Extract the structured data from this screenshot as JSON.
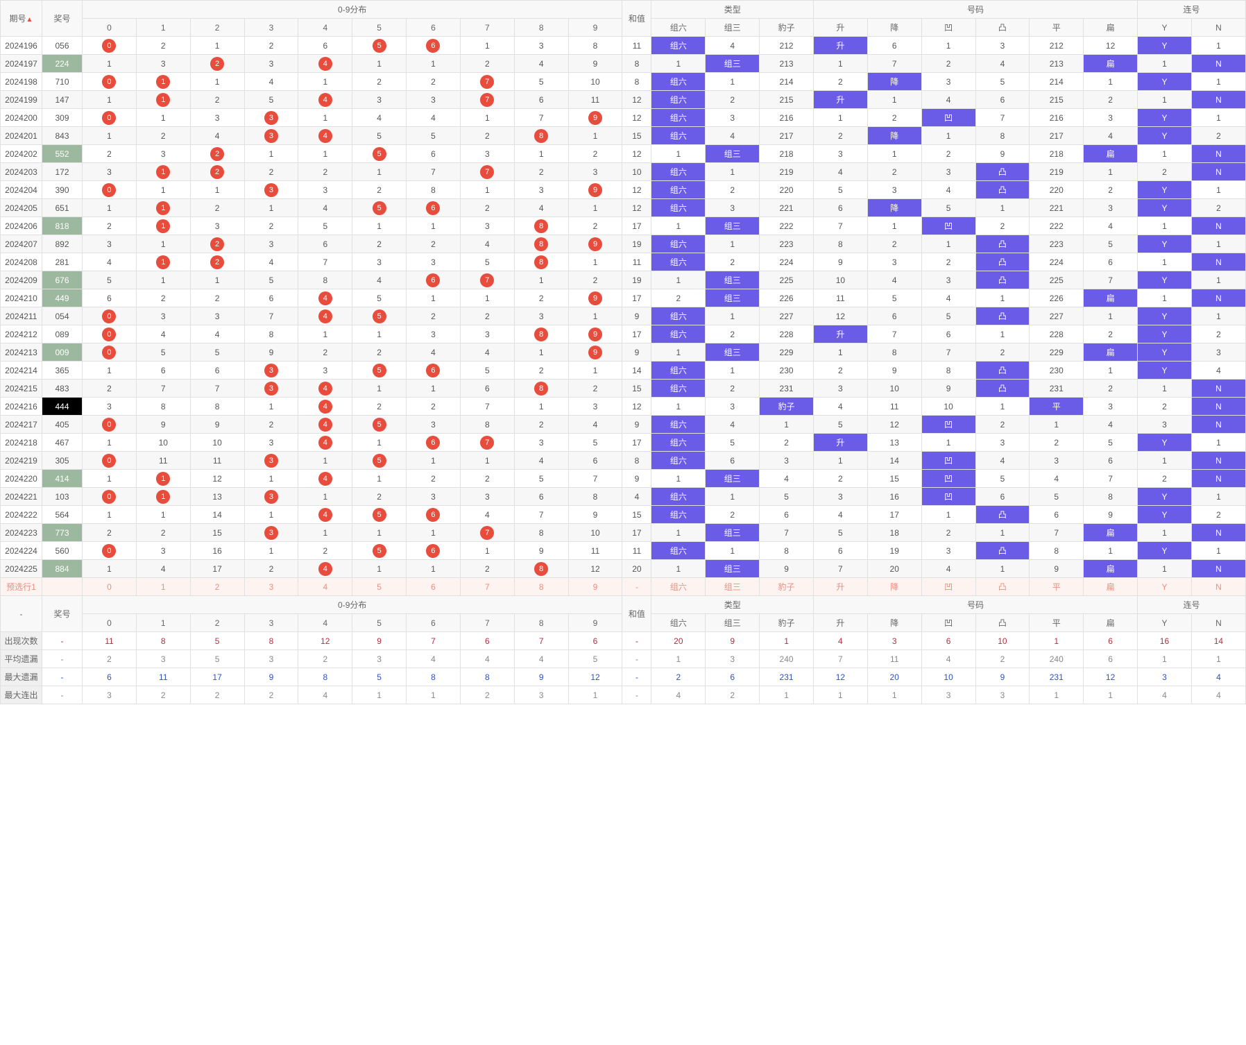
{
  "headers": {
    "period": "期号",
    "award": "奖号",
    "dist": "0-9分布",
    "sum": "和值",
    "type": "类型",
    "num": "号码",
    "con": "连号",
    "type_cols": [
      "组六",
      "组三",
      "豹子"
    ],
    "num_cols": [
      "升",
      "降",
      "凹",
      "凸",
      "平",
      "扁"
    ],
    "con_cols": [
      "Y",
      "N"
    ],
    "dist_cols": [
      "0",
      "1",
      "2",
      "3",
      "4",
      "5",
      "6",
      "7",
      "8",
      "9"
    ]
  },
  "rows": [
    {
      "p": "2024196",
      "a": "056",
      "d": [
        0,
        2,
        1,
        2,
        6,
        5,
        6,
        1,
        3,
        8
      ],
      "h": [
        0,
        5,
        6
      ],
      "sum": 11,
      "t": [
        "组六",
        4,
        212
      ],
      "th": [
        0
      ],
      "n": [
        "升",
        6,
        1,
        3,
        212,
        12
      ],
      "nh": [
        0
      ],
      "c": [
        "Y",
        1
      ],
      "ch": [
        0
      ]
    },
    {
      "p": "2024197",
      "a": "224",
      "ag": 1,
      "d": [
        1,
        3,
        2,
        3,
        4,
        1,
        1,
        2,
        4,
        9
      ],
      "h": [
        2,
        4
      ],
      "sum": 8,
      "t": [
        1,
        "组三",
        213
      ],
      "th": [
        1
      ],
      "n": [
        1,
        7,
        2,
        4,
        213,
        "扁"
      ],
      "nh": [
        5
      ],
      "c": [
        1,
        "N"
      ],
      "ch": [
        1
      ]
    },
    {
      "p": "2024198",
      "a": "710",
      "d": [
        0,
        1,
        1,
        4,
        1,
        2,
        2,
        7,
        5,
        10
      ],
      "h": [
        0,
        1,
        7
      ],
      "sum": 8,
      "t": [
        "组六",
        1,
        214
      ],
      "th": [
        0
      ],
      "n": [
        2,
        "降",
        3,
        5,
        214,
        1
      ],
      "nh": [
        1
      ],
      "c": [
        "Y",
        1
      ],
      "ch": [
        0
      ]
    },
    {
      "p": "2024199",
      "a": "147",
      "d": [
        1,
        1,
        2,
        5,
        4,
        3,
        3,
        7,
        6,
        11
      ],
      "h": [
        1,
        4,
        7
      ],
      "sum": 12,
      "t": [
        "组六",
        2,
        215
      ],
      "th": [
        0
      ],
      "n": [
        "升",
        1,
        4,
        6,
        215,
        2
      ],
      "nh": [
        0
      ],
      "c": [
        1,
        "N"
      ],
      "ch": [
        1
      ]
    },
    {
      "p": "2024200",
      "a": "309",
      "d": [
        0,
        1,
        3,
        3,
        1,
        4,
        4,
        1,
        7,
        9
      ],
      "h": [
        0,
        3,
        9
      ],
      "sum": 12,
      "t": [
        "组六",
        3,
        216
      ],
      "th": [
        0
      ],
      "n": [
        1,
        2,
        "凹",
        7,
        216,
        3
      ],
      "nh": [
        2
      ],
      "c": [
        "Y",
        1
      ],
      "ch": [
        0
      ]
    },
    {
      "p": "2024201",
      "a": "843",
      "d": [
        1,
        2,
        4,
        3,
        4,
        5,
        5,
        2,
        8,
        1
      ],
      "h": [
        3,
        4,
        8
      ],
      "sum": 15,
      "t": [
        "组六",
        4,
        217
      ],
      "th": [
        0
      ],
      "n": [
        2,
        "降",
        1,
        8,
        217,
        4
      ],
      "nh": [
        1
      ],
      "c": [
        "Y",
        2
      ],
      "ch": [
        0
      ]
    },
    {
      "p": "2024202",
      "a": "552",
      "ag": 1,
      "d": [
        2,
        3,
        2,
        1,
        1,
        5,
        6,
        3,
        1,
        2
      ],
      "h": [
        2,
        5
      ],
      "sum": 12,
      "t": [
        1,
        "组三",
        218
      ],
      "th": [
        1
      ],
      "n": [
        3,
        1,
        2,
        9,
        218,
        "扁"
      ],
      "nh": [
        5
      ],
      "c": [
        1,
        "N"
      ],
      "ch": [
        1
      ]
    },
    {
      "p": "2024203",
      "a": "172",
      "d": [
        3,
        1,
        2,
        2,
        2,
        1,
        7,
        7,
        2,
        3
      ],
      "h": [
        1,
        2,
        7
      ],
      "sum": 10,
      "t": [
        "组六",
        1,
        219
      ],
      "th": [
        0
      ],
      "n": [
        4,
        2,
        3,
        "凸",
        219,
        1
      ],
      "nh": [
        3
      ],
      "c": [
        2,
        "N"
      ],
      "ch": [
        1
      ]
    },
    {
      "p": "2024204",
      "a": "390",
      "d": [
        0,
        1,
        1,
        3,
        3,
        2,
        8,
        1,
        3,
        9
      ],
      "h": [
        0,
        3,
        9
      ],
      "sum": 12,
      "t": [
        "组六",
        2,
        220
      ],
      "th": [
        0
      ],
      "n": [
        5,
        3,
        4,
        "凸",
        220,
        2
      ],
      "nh": [
        3
      ],
      "c": [
        "Y",
        1
      ],
      "ch": [
        0
      ]
    },
    {
      "p": "2024205",
      "a": "651",
      "d": [
        1,
        1,
        2,
        1,
        4,
        5,
        6,
        2,
        4,
        1
      ],
      "h": [
        1,
        5,
        6
      ],
      "sum": 12,
      "t": [
        "组六",
        3,
        221
      ],
      "th": [
        0
      ],
      "n": [
        6,
        "降",
        5,
        1,
        221,
        3
      ],
      "nh": [
        1
      ],
      "c": [
        "Y",
        2
      ],
      "ch": [
        0
      ]
    },
    {
      "p": "2024206",
      "a": "818",
      "ag": 1,
      "d": [
        2,
        1,
        3,
        2,
        5,
        1,
        1,
        3,
        8,
        2
      ],
      "h": [
        1,
        8
      ],
      "sum": 17,
      "t": [
        1,
        "组三",
        222
      ],
      "th": [
        1
      ],
      "n": [
        7,
        1,
        "凹",
        2,
        222,
        4
      ],
      "nh": [
        2
      ],
      "c": [
        1,
        "N"
      ],
      "ch": [
        1
      ]
    },
    {
      "p": "2024207",
      "a": "892",
      "d": [
        3,
        1,
        2,
        3,
        6,
        2,
        2,
        4,
        8,
        9
      ],
      "h": [
        2,
        8,
        9
      ],
      "sum": 19,
      "t": [
        "组六",
        1,
        223
      ],
      "th": [
        0
      ],
      "n": [
        8,
        2,
        1,
        "凸",
        223,
        5
      ],
      "nh": [
        3
      ],
      "c": [
        "Y",
        1
      ],
      "ch": [
        0
      ]
    },
    {
      "p": "2024208",
      "a": "281",
      "d": [
        4,
        1,
        2,
        4,
        7,
        3,
        3,
        5,
        8,
        1
      ],
      "h": [
        1,
        2,
        8
      ],
      "sum": 11,
      "t": [
        "组六",
        2,
        224
      ],
      "th": [
        0
      ],
      "n": [
        9,
        3,
        2,
        "凸",
        224,
        6
      ],
      "nh": [
        3
      ],
      "c": [
        1,
        "N"
      ],
      "ch": [
        1
      ]
    },
    {
      "p": "2024209",
      "a": "676",
      "ag": 1,
      "d": [
        5,
        1,
        1,
        5,
        8,
        4,
        6,
        7,
        1,
        2
      ],
      "h": [
        6,
        7
      ],
      "sum": 19,
      "t": [
        1,
        "组三",
        225
      ],
      "th": [
        1
      ],
      "n": [
        10,
        4,
        3,
        "凸",
        225,
        7
      ],
      "nh": [
        3
      ],
      "c": [
        "Y",
        1
      ],
      "ch": [
        0
      ]
    },
    {
      "p": "2024210",
      "a": "449",
      "ag": 1,
      "d": [
        6,
        2,
        2,
        6,
        4,
        5,
        1,
        1,
        2,
        9
      ],
      "h": [
        4,
        9
      ],
      "sum": 17,
      "t": [
        2,
        "组三",
        226
      ],
      "th": [
        1
      ],
      "n": [
        11,
        5,
        4,
        1,
        226,
        "扁"
      ],
      "nh": [
        5
      ],
      "c": [
        1,
        "N"
      ],
      "ch": [
        1
      ]
    },
    {
      "p": "2024211",
      "a": "054",
      "d": [
        0,
        3,
        3,
        7,
        4,
        5,
        2,
        2,
        3,
        1
      ],
      "h": [
        0,
        4,
        5
      ],
      "sum": 9,
      "t": [
        "组六",
        1,
        227
      ],
      "th": [
        0
      ],
      "n": [
        12,
        6,
        5,
        "凸",
        227,
        1
      ],
      "nh": [
        3
      ],
      "c": [
        "Y",
        1
      ],
      "ch": [
        0
      ]
    },
    {
      "p": "2024212",
      "a": "089",
      "d": [
        0,
        4,
        4,
        8,
        1,
        1,
        3,
        3,
        8,
        9
      ],
      "h": [
        0,
        8,
        9
      ],
      "sum": 17,
      "t": [
        "组六",
        2,
        228
      ],
      "th": [
        0
      ],
      "n": [
        "升",
        7,
        6,
        1,
        228,
        2
      ],
      "nh": [
        0
      ],
      "c": [
        "Y",
        2
      ],
      "ch": [
        0
      ]
    },
    {
      "p": "2024213",
      "a": "009",
      "ag": 1,
      "d": [
        0,
        5,
        5,
        9,
        2,
        2,
        4,
        4,
        1,
        9
      ],
      "h": [
        0,
        9
      ],
      "sum": 9,
      "t": [
        1,
        "组三",
        229
      ],
      "th": [
        1
      ],
      "n": [
        1,
        8,
        7,
        2,
        229,
        "扁"
      ],
      "nh": [
        5
      ],
      "c": [
        "Y",
        3
      ],
      "ch": [
        0
      ]
    },
    {
      "p": "2024214",
      "a": "365",
      "d": [
        1,
        6,
        6,
        3,
        3,
        5,
        6,
        5,
        2,
        1
      ],
      "h": [
        3,
        5,
        6
      ],
      "sum": 14,
      "t": [
        "组六",
        1,
        230
      ],
      "th": [
        0
      ],
      "n": [
        2,
        9,
        8,
        "凸",
        230,
        1
      ],
      "nh": [
        3
      ],
      "c": [
        "Y",
        4
      ],
      "ch": [
        0
      ]
    },
    {
      "p": "2024215",
      "a": "483",
      "d": [
        2,
        7,
        7,
        3,
        4,
        1,
        1,
        6,
        8,
        2
      ],
      "h": [
        3,
        4,
        8
      ],
      "sum": 15,
      "t": [
        "组六",
        2,
        231
      ],
      "th": [
        0
      ],
      "n": [
        3,
        10,
        9,
        "凸",
        231,
        2
      ],
      "nh": [
        3
      ],
      "c": [
        1,
        "N"
      ],
      "ch": [
        1
      ]
    },
    {
      "p": "2024216",
      "a": "444",
      "ab": 1,
      "d": [
        3,
        8,
        8,
        1,
        4,
        2,
        2,
        7,
        1,
        3
      ],
      "h": [
        4
      ],
      "sum": 12,
      "t": [
        1,
        3,
        "豹子"
      ],
      "th": [
        2
      ],
      "n": [
        4,
        11,
        10,
        1,
        "平",
        3
      ],
      "nh": [
        4
      ],
      "c": [
        2,
        "N"
      ],
      "ch": [
        1
      ]
    },
    {
      "p": "2024217",
      "a": "405",
      "d": [
        0,
        9,
        9,
        2,
        4,
        5,
        3,
        8,
        2,
        4
      ],
      "h": [
        0,
        4,
        5
      ],
      "sum": 9,
      "t": [
        "组六",
        4,
        1
      ],
      "th": [
        0
      ],
      "n": [
        5,
        12,
        "凹",
        2,
        1,
        4
      ],
      "nh": [
        2
      ],
      "c": [
        3,
        "N"
      ],
      "ch": [
        1
      ]
    },
    {
      "p": "2024218",
      "a": "467",
      "d": [
        1,
        10,
        10,
        3,
        4,
        1,
        6,
        7,
        3,
        5
      ],
      "h": [
        4,
        6,
        7
      ],
      "sum": 17,
      "t": [
        "组六",
        5,
        2
      ],
      "th": [
        0
      ],
      "n": [
        "升",
        13,
        1,
        3,
        2,
        5
      ],
      "nh": [
        0
      ],
      "c": [
        "Y",
        1
      ],
      "ch": [
        0
      ]
    },
    {
      "p": "2024219",
      "a": "305",
      "d": [
        0,
        11,
        11,
        3,
        1,
        5,
        1,
        1,
        4,
        6
      ],
      "h": [
        0,
        3,
        5
      ],
      "sum": 8,
      "t": [
        "组六",
        6,
        3
      ],
      "th": [
        0
      ],
      "n": [
        1,
        14,
        "凹",
        4,
        3,
        6
      ],
      "nh": [
        2
      ],
      "c": [
        1,
        "N"
      ],
      "ch": [
        1
      ]
    },
    {
      "p": "2024220",
      "a": "414",
      "ag": 1,
      "d": [
        1,
        1,
        12,
        1,
        4,
        1,
        2,
        2,
        5,
        7
      ],
      "h": [
        1,
        4
      ],
      "sum": 9,
      "t": [
        1,
        "组三",
        4
      ],
      "th": [
        1
      ],
      "n": [
        2,
        15,
        "凹",
        5,
        4,
        7
      ],
      "nh": [
        2
      ],
      "c": [
        2,
        "N"
      ],
      "ch": [
        1
      ]
    },
    {
      "p": "2024221",
      "a": "103",
      "d": [
        0,
        1,
        13,
        3,
        1,
        2,
        3,
        3,
        6,
        8
      ],
      "h": [
        0,
        1,
        3
      ],
      "sum": 4,
      "t": [
        "组六",
        1,
        5
      ],
      "th": [
        0
      ],
      "n": [
        3,
        16,
        "凹",
        6,
        5,
        8
      ],
      "nh": [
        2
      ],
      "c": [
        "Y",
        1
      ],
      "ch": [
        0
      ]
    },
    {
      "p": "2024222",
      "a": "564",
      "d": [
        1,
        1,
        14,
        1,
        4,
        5,
        6,
        4,
        7,
        9
      ],
      "h": [
        4,
        5,
        6
      ],
      "sum": 15,
      "t": [
        "组六",
        2,
        6
      ],
      "th": [
        0
      ],
      "n": [
        4,
        17,
        1,
        "凸",
        6,
        9
      ],
      "nh": [
        3
      ],
      "c": [
        "Y",
        2
      ],
      "ch": [
        0
      ]
    },
    {
      "p": "2024223",
      "a": "773",
      "ag": 1,
      "d": [
        2,
        2,
        15,
        3,
        1,
        1,
        1,
        7,
        8,
        10
      ],
      "h": [
        3,
        7
      ],
      "sum": 17,
      "t": [
        1,
        "组三",
        7
      ],
      "th": [
        1
      ],
      "n": [
        5,
        18,
        2,
        1,
        7,
        "扁"
      ],
      "nh": [
        5
      ],
      "c": [
        1,
        "N"
      ],
      "ch": [
        1
      ]
    },
    {
      "p": "2024224",
      "a": "560",
      "d": [
        0,
        3,
        16,
        1,
        2,
        5,
        6,
        1,
        9,
        11
      ],
      "h": [
        0,
        5,
        6
      ],
      "sum": 11,
      "t": [
        "组六",
        1,
        8
      ],
      "th": [
        0
      ],
      "n": [
        6,
        19,
        3,
        "凸",
        8,
        1
      ],
      "nh": [
        3
      ],
      "c": [
        "Y",
        1
      ],
      "ch": [
        0
      ]
    },
    {
      "p": "2024225",
      "a": "884",
      "ag": 1,
      "d": [
        1,
        4,
        17,
        2,
        4,
        1,
        1,
        2,
        8,
        12
      ],
      "h": [
        4,
        8
      ],
      "sum": 20,
      "t": [
        1,
        "组三",
        9
      ],
      "th": [
        1
      ],
      "n": [
        7,
        20,
        4,
        1,
        9,
        "扁"
      ],
      "nh": [
        5
      ],
      "c": [
        1,
        "N"
      ],
      "ch": [
        1
      ]
    }
  ],
  "predict": {
    "label": "预选行1",
    "d": [
      "0",
      "1",
      "2",
      "3",
      "4",
      "5",
      "6",
      "7",
      "8",
      "9"
    ],
    "sum": "-",
    "t": [
      "组六",
      "组三",
      "豹子"
    ],
    "n": [
      "升",
      "降",
      "凹",
      "凸",
      "平",
      "扁"
    ],
    "c": [
      "Y",
      "N"
    ]
  },
  "stats": [
    {
      "cls": "stat-red",
      "label": "出现次数",
      "a": "-",
      "d": [
        11,
        8,
        5,
        8,
        12,
        9,
        7,
        6,
        7,
        6
      ],
      "sum": "-",
      "t": [
        20,
        9,
        1
      ],
      "n": [
        4,
        3,
        6,
        10,
        1,
        6
      ],
      "c": [
        16,
        14
      ]
    },
    {
      "cls": "stat-gray",
      "label": "平均遗漏",
      "a": "-",
      "d": [
        2,
        3,
        5,
        3,
        2,
        3,
        4,
        4,
        4,
        5
      ],
      "sum": "-",
      "t": [
        1,
        3,
        240
      ],
      "n": [
        7,
        11,
        4,
        2,
        240,
        6
      ],
      "c": [
        1,
        1
      ]
    },
    {
      "cls": "stat-blue",
      "label": "最大遗漏",
      "a": "-",
      "d": [
        6,
        11,
        17,
        9,
        8,
        5,
        8,
        8,
        9,
        12
      ],
      "sum": "-",
      "t": [
        2,
        6,
        231
      ],
      "n": [
        12,
        20,
        10,
        9,
        231,
        12
      ],
      "c": [
        3,
        4
      ]
    },
    {
      "cls": "stat-gray",
      "label": "最大连出",
      "a": "-",
      "d": [
        3,
        2,
        2,
        2,
        4,
        1,
        1,
        2,
        3,
        1
      ],
      "sum": "-",
      "t": [
        4,
        2,
        1
      ],
      "n": [
        1,
        1,
        3,
        3,
        1,
        1
      ],
      "c": [
        4,
        4
      ]
    }
  ],
  "footer_dash": "-"
}
